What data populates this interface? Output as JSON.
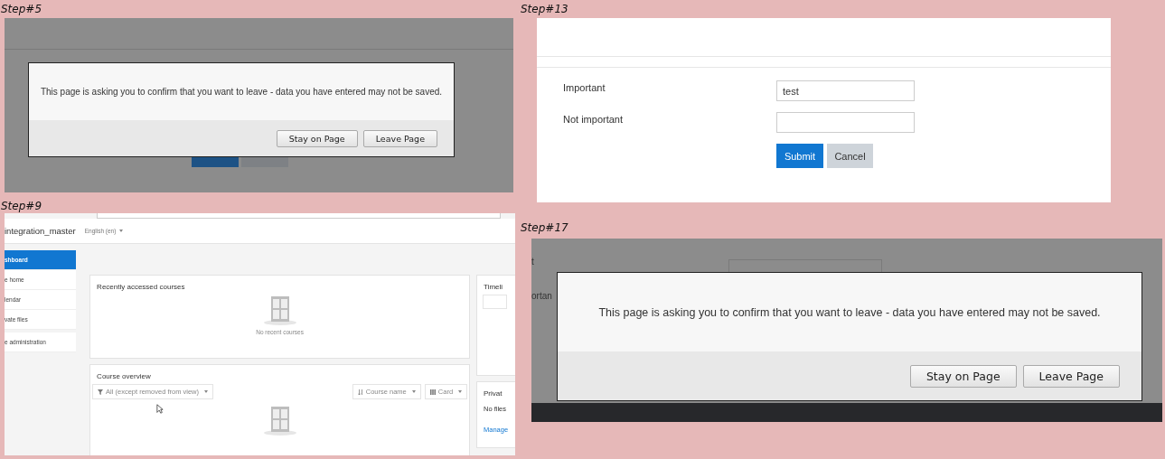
{
  "steps": [
    {
      "label": "Step#5"
    },
    {
      "label": "Step#9"
    },
    {
      "label": "Step#13"
    },
    {
      "label": "Step#17"
    }
  ],
  "step5": {
    "dialog": {
      "message": "This page is asking you to confirm that you want to leave - data you have entered may not be saved.",
      "buttons": [
        "Stay on Page",
        "Leave Page"
      ]
    }
  },
  "step9": {
    "site_name": "integration_master",
    "language": "English (en)",
    "nav": [
      {
        "label": "shboard",
        "selected": true
      },
      {
        "label": "e home",
        "selected": false
      },
      {
        "label": "lendar",
        "selected": false
      },
      {
        "label": "vate files",
        "selected": false
      },
      {
        "label": "e administration",
        "selected": false
      }
    ],
    "recent": {
      "title": "Recently accessed courses",
      "empty": "No recent courses"
    },
    "overview": {
      "title": "Course overview",
      "filter": "All (except removed from view)",
      "sort": "Course name",
      "view": "Card"
    },
    "timeline": {
      "title": "Timeli"
    },
    "private": {
      "title": "Privat",
      "empty": "No files",
      "link": "Manage"
    }
  },
  "step13": {
    "fields": [
      {
        "label": "Important",
        "value": "test"
      },
      {
        "label": "Not important"
      }
    ],
    "submit": "Submit",
    "cancel": "Cancel"
  },
  "step17": {
    "labels": [
      "t",
      "ortan"
    ],
    "dialog": {
      "message": "This page is asking you to confirm that you want to leave - data you have entered may not be saved.",
      "buttons": [
        "Stay on Page",
        "Leave Page"
      ]
    }
  }
}
